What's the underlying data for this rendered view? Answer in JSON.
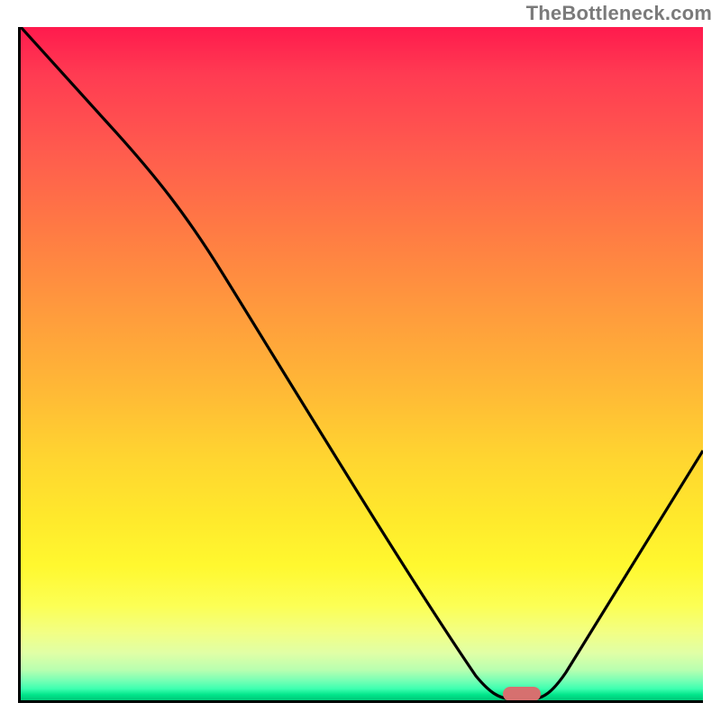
{
  "watermark": "TheBottleneck.com",
  "chart_data": {
    "type": "line",
    "title": "",
    "xlabel": "",
    "ylabel": "",
    "xlim": [
      0,
      100
    ],
    "ylim": [
      0,
      100
    ],
    "x": [
      0,
      25,
      70,
      74,
      100
    ],
    "y": [
      100,
      72,
      0,
      0,
      38
    ],
    "annotations": [
      {
        "type": "marker",
        "shape": "pill",
        "color": "#d6706f",
        "x": 73,
        "y": 0
      }
    ],
    "background": "vertical-gradient-red-to-green",
    "grid": false,
    "legend": false
  },
  "colors": {
    "curve": "#000000",
    "axis": "#000000",
    "watermark": "#7a7a7a",
    "marker": "#d6706f"
  }
}
